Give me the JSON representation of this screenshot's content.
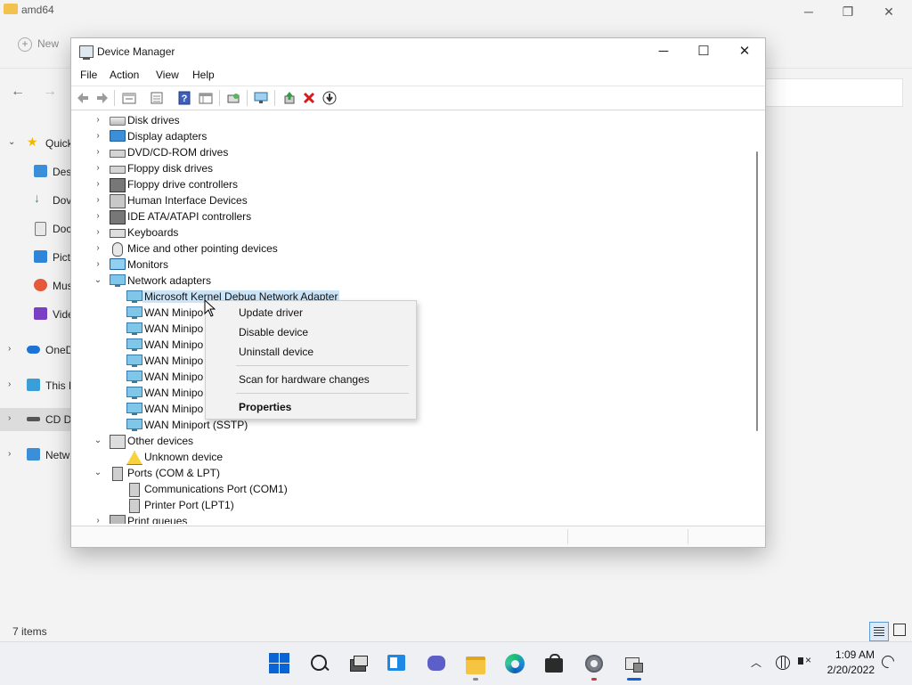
{
  "explorer": {
    "title": "amd64",
    "new_label": "New",
    "status_text": "7 items",
    "sidebar": [
      {
        "label": "Quick",
        "icon": "star-icon"
      },
      {
        "label": "Des",
        "icon": "desktop-icon"
      },
      {
        "label": "Dov",
        "icon": "download-icon"
      },
      {
        "label": "Doc",
        "icon": "document-icon"
      },
      {
        "label": "Pict",
        "icon": "pictures-icon"
      },
      {
        "label": "Mus",
        "icon": "music-icon"
      },
      {
        "label": "Vide",
        "icon": "video-icon"
      },
      {
        "label": "OneD",
        "icon": "cloud-icon"
      },
      {
        "label": "This F",
        "icon": "pc-icon"
      },
      {
        "label": "CD D",
        "icon": "cd-drive-icon"
      },
      {
        "label": "Netw",
        "icon": "network-icon"
      }
    ]
  },
  "device_manager": {
    "title": "Device Manager",
    "menu": [
      "File",
      "Action",
      "View",
      "Help"
    ],
    "toolbar_icons": [
      "back-icon",
      "forward-icon",
      "properties-view-icon",
      "list-view-icon",
      "help-icon",
      "resources-icon",
      "scan-icon",
      "monitor-icon",
      "update-driver-icon",
      "uninstall-icon",
      "download-icon"
    ],
    "tree": [
      {
        "label": "Disk drives",
        "icon": "disk-icon",
        "level": 0,
        "expanded": false
      },
      {
        "label": "Display adapters",
        "icon": "monitor-icon",
        "level": 0,
        "expanded": false
      },
      {
        "label": "DVD/CD-ROM drives",
        "icon": "dvd-icon",
        "level": 0,
        "expanded": false
      },
      {
        "label": "Floppy disk drives",
        "icon": "floppy-icon",
        "level": 0,
        "expanded": false
      },
      {
        "label": "Floppy drive controllers",
        "icon": "controller-icon",
        "level": 0,
        "expanded": false
      },
      {
        "label": "Human Interface Devices",
        "icon": "hid-icon",
        "level": 0,
        "expanded": false
      },
      {
        "label": "IDE ATA/ATAPI controllers",
        "icon": "ide-icon",
        "level": 0,
        "expanded": false
      },
      {
        "label": "Keyboards",
        "icon": "keyboard-icon",
        "level": 0,
        "expanded": false
      },
      {
        "label": "Mice and other pointing devices",
        "icon": "mouse-icon",
        "level": 0,
        "expanded": false
      },
      {
        "label": "Monitors",
        "icon": "monitor-icon",
        "level": 0,
        "expanded": false
      },
      {
        "label": "Network adapters",
        "icon": "network-icon",
        "level": 0,
        "expanded": true
      },
      {
        "label": "Microsoft Kernel Debug Network Adapter",
        "icon": "network-icon",
        "level": 1,
        "selected": true
      },
      {
        "label": "WAN Minipo",
        "icon": "network-icon",
        "level": 1
      },
      {
        "label": "WAN Minipo",
        "icon": "network-icon",
        "level": 1
      },
      {
        "label": "WAN Minipo",
        "icon": "network-icon",
        "level": 1
      },
      {
        "label": "WAN Minipo",
        "icon": "network-icon",
        "level": 1
      },
      {
        "label": "WAN Minipo",
        "icon": "network-icon",
        "level": 1
      },
      {
        "label": "WAN Minipo",
        "icon": "network-icon",
        "level": 1
      },
      {
        "label": "WAN Minipo",
        "icon": "network-icon",
        "level": 1
      },
      {
        "label": "WAN Miniport (SSTP)",
        "icon": "network-icon",
        "level": 1
      },
      {
        "label": "Other devices",
        "icon": "other-device-icon",
        "level": 0,
        "expanded": true
      },
      {
        "label": "Unknown device",
        "icon": "warning-icon",
        "level": 1
      },
      {
        "label": "Ports (COM & LPT)",
        "icon": "port-icon",
        "level": 0,
        "expanded": true
      },
      {
        "label": "Communications Port (COM1)",
        "icon": "port-icon",
        "level": 1
      },
      {
        "label": "Printer Port (LPT1)",
        "icon": "port-icon",
        "level": 1
      },
      {
        "label": "Print queues",
        "icon": "printer-icon",
        "level": 0,
        "expanded": false
      }
    ],
    "context_menu": [
      {
        "label": "Update driver",
        "bold": false
      },
      {
        "label": "Disable device",
        "bold": false
      },
      {
        "label": "Uninstall device",
        "bold": false
      },
      {
        "label": "Scan for hardware changes",
        "bold": false
      },
      {
        "label": "Properties",
        "bold": true
      }
    ]
  },
  "taskbar": {
    "time": "1:09 AM",
    "date": "2/20/2022",
    "apps": [
      "start-icon",
      "search-icon",
      "task-view-icon",
      "widgets-icon",
      "chat-icon",
      "file-explorer-icon",
      "edge-icon",
      "store-icon",
      "settings-icon",
      "device-manager-icon"
    ],
    "accent": "#0a64d6"
  }
}
